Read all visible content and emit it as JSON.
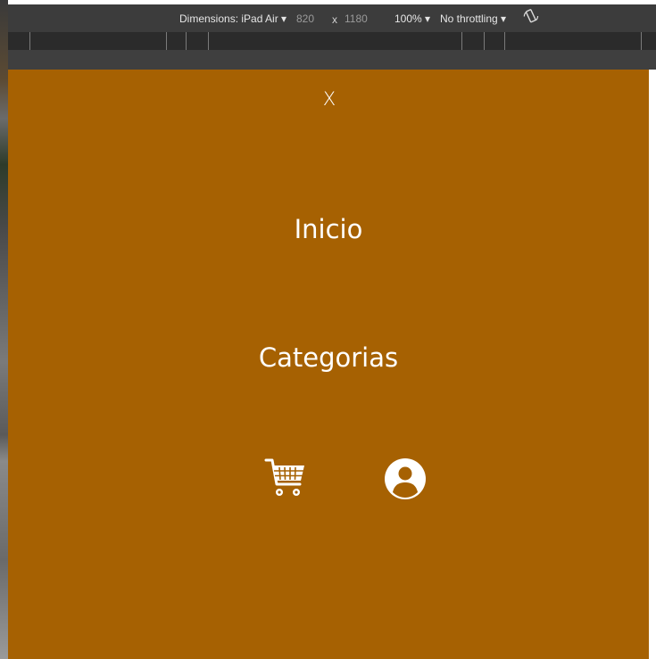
{
  "devtools": {
    "dimensions_label": "Dimensions: iPad Air ▾",
    "width": "820",
    "times": "x",
    "height": "1180",
    "zoom": "100% ▾",
    "throttling": "No throttling ▾",
    "rotate_icon": "rotate-icon"
  },
  "menu": {
    "close_label": "X",
    "items": [
      {
        "label": "Inicio"
      },
      {
        "label": "Categorias"
      }
    ],
    "icons": [
      "cart-icon",
      "user-icon"
    ]
  },
  "colors": {
    "menu_background": "#a66102",
    "devtools_bar": "#3c3c3c",
    "text": "#ffffff"
  }
}
